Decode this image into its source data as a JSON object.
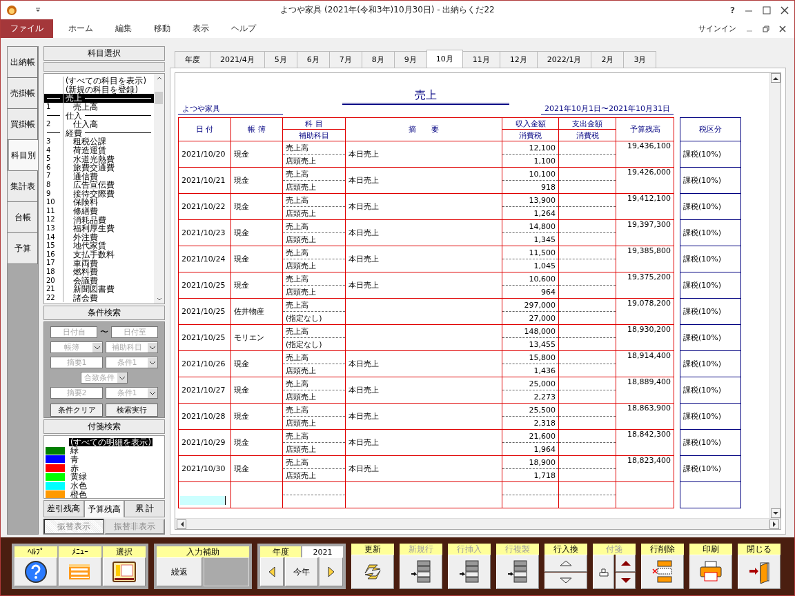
{
  "window": {
    "title": "よつや家具 (2021年(令和3年)10月30日) - 出納らくだ22",
    "help": "?"
  },
  "menu": [
    {
      "label": "ファイル",
      "selected": true
    },
    {
      "label": "ホーム",
      "selected": false
    },
    {
      "label": "編集",
      "selected": false
    },
    {
      "label": "移動",
      "selected": false
    },
    {
      "label": "表示",
      "selected": false
    },
    {
      "label": "ヘルプ",
      "selected": false
    }
  ],
  "sign_in": "サインイン",
  "side_tabs": [
    {
      "label": "出納帳",
      "selected": false
    },
    {
      "label": "売掛帳",
      "selected": false
    },
    {
      "label": "買掛帳",
      "selected": false
    },
    {
      "label": "科目別",
      "selected": true
    },
    {
      "label": "集計表",
      "selected": false
    },
    {
      "label": "台帳",
      "selected": false
    },
    {
      "label": "予算",
      "selected": false
    }
  ],
  "subject_panel": {
    "title": "科目選択",
    "items": [
      {
        "kind": "special",
        "name": "(すべての科目を表示)",
        "selected": false
      },
      {
        "kind": "special",
        "name": "(新規の科目を登録)",
        "selected": false
      },
      {
        "kind": "header",
        "name": "売上",
        "selected": true
      },
      {
        "kind": "item",
        "number": "1",
        "name": "売上高",
        "selected": false
      },
      {
        "kind": "header",
        "name": "仕入",
        "selected": false
      },
      {
        "kind": "item",
        "number": "2",
        "name": "仕入高",
        "selected": false
      },
      {
        "kind": "header",
        "name": "経費",
        "selected": false
      },
      {
        "kind": "item",
        "number": "3",
        "name": "租税公課",
        "selected": false
      },
      {
        "kind": "item",
        "number": "4",
        "name": "荷造運賃",
        "selected": false
      },
      {
        "kind": "item",
        "number": "5",
        "name": "水道光熱費",
        "selected": false
      },
      {
        "kind": "item",
        "number": "6",
        "name": "旅費交通費",
        "selected": false
      },
      {
        "kind": "item",
        "number": "7",
        "name": "通信費",
        "selected": false
      },
      {
        "kind": "item",
        "number": "8",
        "name": "広告宣伝費",
        "selected": false
      },
      {
        "kind": "item",
        "number": "9",
        "name": "接待交際費",
        "selected": false
      },
      {
        "kind": "item",
        "number": "10",
        "name": "保険料",
        "selected": false
      },
      {
        "kind": "item",
        "number": "11",
        "name": "修繕費",
        "selected": false
      },
      {
        "kind": "item",
        "number": "12",
        "name": "消耗品費",
        "selected": false
      },
      {
        "kind": "item",
        "number": "13",
        "name": "福利厚生費",
        "selected": false
      },
      {
        "kind": "item",
        "number": "14",
        "name": "外注費",
        "selected": false
      },
      {
        "kind": "item",
        "number": "15",
        "name": "地代家賃",
        "selected": false
      },
      {
        "kind": "item",
        "number": "16",
        "name": "支払手数料",
        "selected": false
      },
      {
        "kind": "item",
        "number": "17",
        "name": "車両費",
        "selected": false
      },
      {
        "kind": "item",
        "number": "18",
        "name": "燃料費",
        "selected": false
      },
      {
        "kind": "item",
        "number": "20",
        "name": "会議費",
        "selected": false
      },
      {
        "kind": "item",
        "number": "21",
        "name": "新聞図書費",
        "selected": false
      },
      {
        "kind": "item",
        "number": "22",
        "name": "諸会費",
        "selected": false
      }
    ]
  },
  "condition_search": {
    "title": "条件検索",
    "rows": [
      [
        {
          "kind": "field",
          "placeholder": "日付自"
        },
        {
          "kind": "text",
          "text": "〜"
        },
        {
          "kind": "field",
          "placeholder": "日付至"
        }
      ],
      [
        {
          "kind": "select",
          "placeholder": "帳簿"
        },
        {
          "kind": "select",
          "placeholder": "補助科目"
        }
      ],
      [
        {
          "kind": "field",
          "placeholder": "摘要1"
        },
        {
          "kind": "select",
          "placeholder": "条件1"
        }
      ],
      [
        {
          "kind": "select",
          "placeholder": "合致条件"
        }
      ],
      [
        {
          "kind": "field",
          "placeholder": "摘要2"
        },
        {
          "kind": "select",
          "placeholder": "条件1"
        }
      ]
    ],
    "buttons": [
      "条件クリア",
      "検索実行"
    ]
  },
  "tag_search": {
    "title": "付箋検索",
    "items": [
      {
        "label": "(すべての明細を表示)",
        "selected": true
      },
      {
        "label": "緑",
        "color": "#008000",
        "selected": false
      },
      {
        "label": "青",
        "color": "#0000ff",
        "selected": false
      },
      {
        "label": "赤",
        "color": "#ff0000",
        "selected": false
      },
      {
        "label": "黄緑",
        "color": "#00ff00",
        "selected": false
      },
      {
        "label": "水色",
        "color": "#00ffff",
        "selected": false
      },
      {
        "label": "橙色",
        "color": "#ff9900",
        "selected": false
      }
    ]
  },
  "balance_tabs": [
    {
      "label": "差引残高",
      "selected": false
    },
    {
      "label": "予算残高",
      "selected": true
    },
    {
      "label": "累 計",
      "selected": false
    }
  ],
  "transfer_buttons": [
    {
      "label": "振替表示",
      "disabled": true,
      "selected": true
    },
    {
      "label": "振替非表示",
      "disabled": true,
      "selected": false
    }
  ],
  "month_tabs": [
    {
      "label": "年度",
      "selected": false
    },
    {
      "label": "2021/4月",
      "selected": false
    },
    {
      "label": "5月",
      "selected": false
    },
    {
      "label": "6月",
      "selected": false
    },
    {
      "label": "7月",
      "selected": false
    },
    {
      "label": "8月",
      "selected": false
    },
    {
      "label": "9月",
      "selected": false
    },
    {
      "label": "10月",
      "selected": true
    },
    {
      "label": "11月",
      "selected": false
    },
    {
      "label": "12月",
      "selected": false
    },
    {
      "label": "2022/1月",
      "selected": false
    },
    {
      "label": "2月",
      "selected": false
    },
    {
      "label": "3月",
      "selected": false
    }
  ],
  "sheet": {
    "title": "売上",
    "company": "よつや家具",
    "period": "2021年10月1日〜2021年10月31日",
    "headers": {
      "date": "日 付",
      "book": "帳 簿",
      "account": "科 目",
      "sub_account": "補助科目",
      "summary": "摘　　要",
      "income": "収入金額",
      "income_tax": "消費税",
      "expense": "支出金額",
      "expense_tax": "消費税",
      "balance": "予算残高",
      "tax_class": "税区分"
    },
    "rows": [
      {
        "date": "2021/10/20",
        "book": "現金",
        "account": "売上高",
        "sub_account": "店頭売上",
        "summary": "本日売上",
        "income": "12,100",
        "income_tax": "1,100",
        "balance": "19,436,100",
        "tax_class": "課税(10%)"
      },
      {
        "date": "2021/10/21",
        "book": "現金",
        "account": "売上高",
        "sub_account": "店頭売上",
        "summary": "本日売上",
        "income": "10,100",
        "income_tax": "918",
        "balance": "19,426,000",
        "tax_class": "課税(10%)"
      },
      {
        "date": "2021/10/22",
        "book": "現金",
        "account": "売上高",
        "sub_account": "店頭売上",
        "summary": "本日売上",
        "income": "13,900",
        "income_tax": "1,264",
        "balance": "19,412,100",
        "tax_class": "課税(10%)"
      },
      {
        "date": "2021/10/23",
        "book": "現金",
        "account": "売上高",
        "sub_account": "店頭売上",
        "summary": "本日売上",
        "income": "14,800",
        "income_tax": "1,345",
        "balance": "19,397,300",
        "tax_class": "課税(10%)"
      },
      {
        "date": "2021/10/24",
        "book": "現金",
        "account": "売上高",
        "sub_account": "店頭売上",
        "summary": "本日売上",
        "income": "11,500",
        "income_tax": "1,045",
        "balance": "19,385,800",
        "tax_class": "課税(10%)"
      },
      {
        "date": "2021/10/25",
        "book": "現金",
        "account": "売上高",
        "sub_account": "店頭売上",
        "summary": "本日売上",
        "income": "10,600",
        "income_tax": "964",
        "balance": "19,375,200",
        "tax_class": "課税(10%)"
      },
      {
        "date": "2021/10/25",
        "book": "佐井物産",
        "account": "売上高",
        "sub_account": "(指定なし)",
        "income": "297,000",
        "income_tax": "27,000",
        "balance": "19,078,200",
        "tax_class": "課税(10%)"
      },
      {
        "date": "2021/10/25",
        "book": "モリエン",
        "account": "売上高",
        "sub_account": "(指定なし)",
        "income": "148,000",
        "income_tax": "13,455",
        "balance": "18,930,200",
        "tax_class": "課税(10%)"
      },
      {
        "date": "2021/10/26",
        "book": "現金",
        "account": "売上高",
        "sub_account": "店頭売上",
        "summary": "本日売上",
        "income": "15,800",
        "income_tax": "1,436",
        "balance": "18,914,400",
        "tax_class": "課税(10%)"
      },
      {
        "date": "2021/10/27",
        "book": "現金",
        "account": "売上高",
        "sub_account": "店頭売上",
        "summary": "本日売上",
        "income": "25,000",
        "income_tax": "2,273",
        "balance": "18,889,400",
        "tax_class": "課税(10%)"
      },
      {
        "date": "2021/10/28",
        "book": "現金",
        "account": "売上高",
        "sub_account": "店頭売上",
        "summary": "本日売上",
        "income": "25,500",
        "income_tax": "2,318",
        "balance": "18,863,900",
        "tax_class": "課税(10%)"
      },
      {
        "date": "2021/10/29",
        "book": "現金",
        "account": "売上高",
        "sub_account": "店頭売上",
        "summary": "本日売上",
        "income": "21,600",
        "income_tax": "1,964",
        "balance": "18,842,300",
        "tax_class": "課税(10%)"
      },
      {
        "date": "2021/10/30",
        "book": "現金",
        "account": "売上高",
        "sub_account": "店頭売上",
        "summary": "本日売上",
        "income": "18,900",
        "income_tax": "1,718",
        "balance": "18,823,400",
        "tax_class": "課税(10%)"
      }
    ]
  },
  "toolbar": [
    {
      "kind": "group",
      "buttons": [
        {
          "kind": "help",
          "label": "ﾍﾙﾌﾟ"
        },
        {
          "kind": "menu",
          "label": "ﾒﾆｭｰ"
        },
        {
          "kind": "select",
          "label": "選択"
        }
      ]
    },
    {
      "kind": "assist",
      "label": "入力補助",
      "button": "繰返"
    },
    {
      "kind": "year",
      "label": "年度",
      "value": "2021",
      "button": "今年"
    },
    {
      "kind": "refresh",
      "label": "更新",
      "disabled": false
    },
    {
      "kind": "new_row",
      "label": "新規行",
      "disabled": true
    },
    {
      "kind": "insert_row",
      "label": "行挿入",
      "disabled": true
    },
    {
      "kind": "copy_row",
      "label": "行複製",
      "disabled": true
    },
    {
      "kind": "swap",
      "label": "行入換",
      "disabled": false
    },
    {
      "kind": "tag",
      "label": "付箋",
      "disabled": true
    },
    {
      "kind": "delete_row",
      "label": "行削除",
      "disabled": false
    },
    {
      "kind": "print",
      "label": "印刷",
      "disabled": false
    },
    {
      "kind": "close",
      "label": "閉じる",
      "disabled": false
    }
  ]
}
